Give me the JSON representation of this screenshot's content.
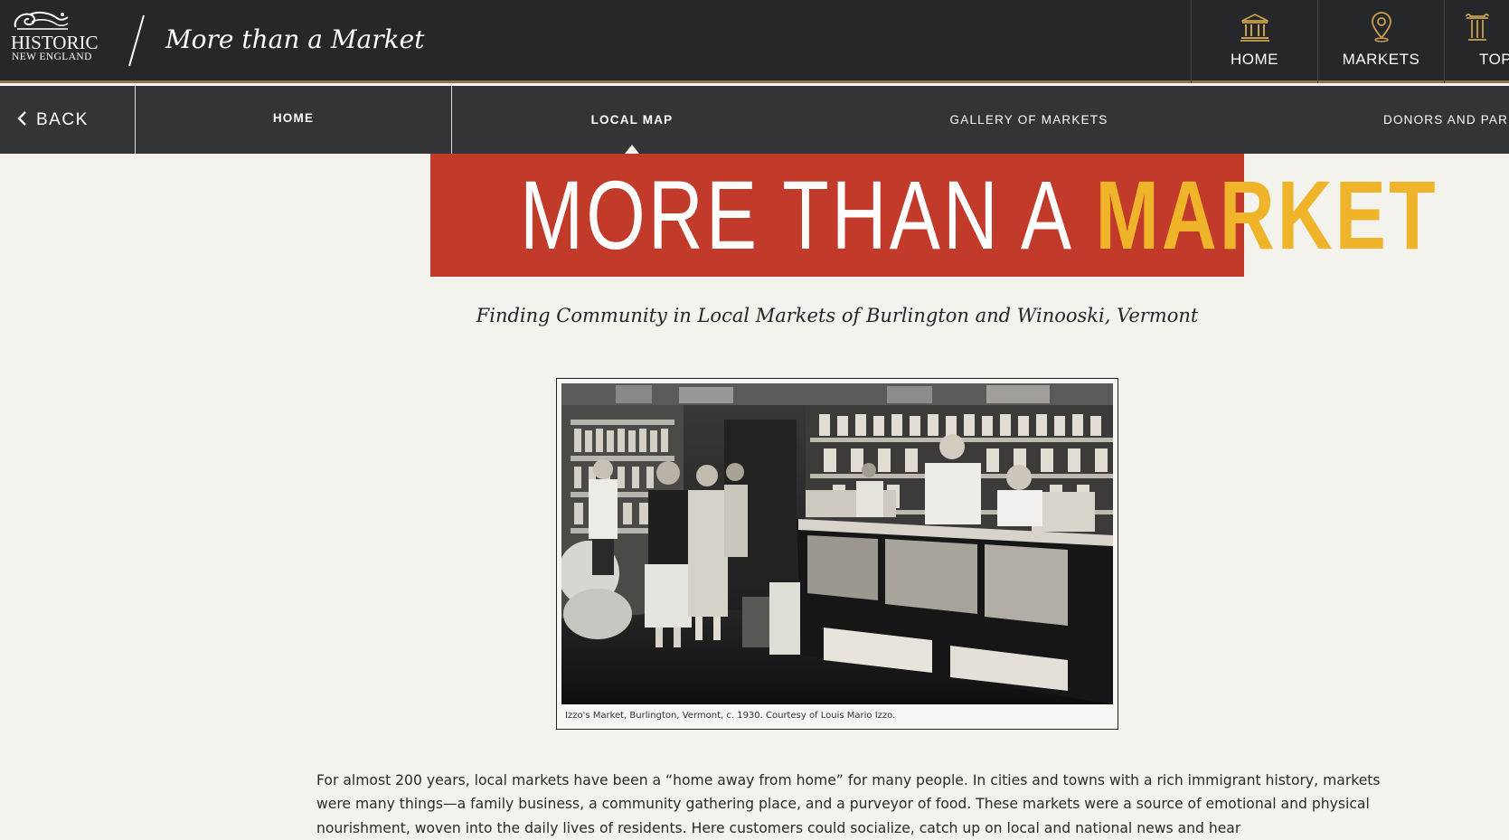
{
  "header": {
    "logo_line1": "HISTORIC",
    "logo_line2": "NEW ENGLAND",
    "site_title": "More than a Market",
    "nav": [
      {
        "label": "HOME",
        "icon": "museum-icon"
      },
      {
        "label": "MARKETS",
        "icon": "map-pin-icon"
      },
      {
        "label": "TOP",
        "icon": "column-icon"
      }
    ]
  },
  "subnav": {
    "back_label": "BACK",
    "items": [
      {
        "label": "HOME"
      },
      {
        "label": "LOCAL MAP",
        "active": true
      },
      {
        "label": "GALLERY OF MARKETS"
      },
      {
        "label": "DONORS AND PAR"
      }
    ]
  },
  "banner": {
    "white_text": "MORE THAN A",
    "gold_text": "MARKET"
  },
  "subtitle": "Finding Community in Local Markets of Burlington and Winooski, Vermont",
  "photo": {
    "caption": "Izzo's Market, Burlington, Vermont, c. 1930. Courtesy of Louis Mario Izzo."
  },
  "body_text": "For almost 200 years, local markets have been a “home away from home” for many people.  In cities and towns with a rich immigrant history, markets were many things—a family business, a community gathering place, and a purveyor of food. These markets were a source of emotional and physical nourishment, woven into the daily lives of residents. Here customers could socialize, catch up on local and national news and hear",
  "colors": {
    "header_bg": "#25272a",
    "accent_gold_line": "#8c7447",
    "icon_gold": "#c9a24a",
    "subnav_bg": "#333436",
    "banner_red": "#c23a2a",
    "banner_gold": "#f0b42a",
    "page_bg": "#f4f2ec"
  }
}
